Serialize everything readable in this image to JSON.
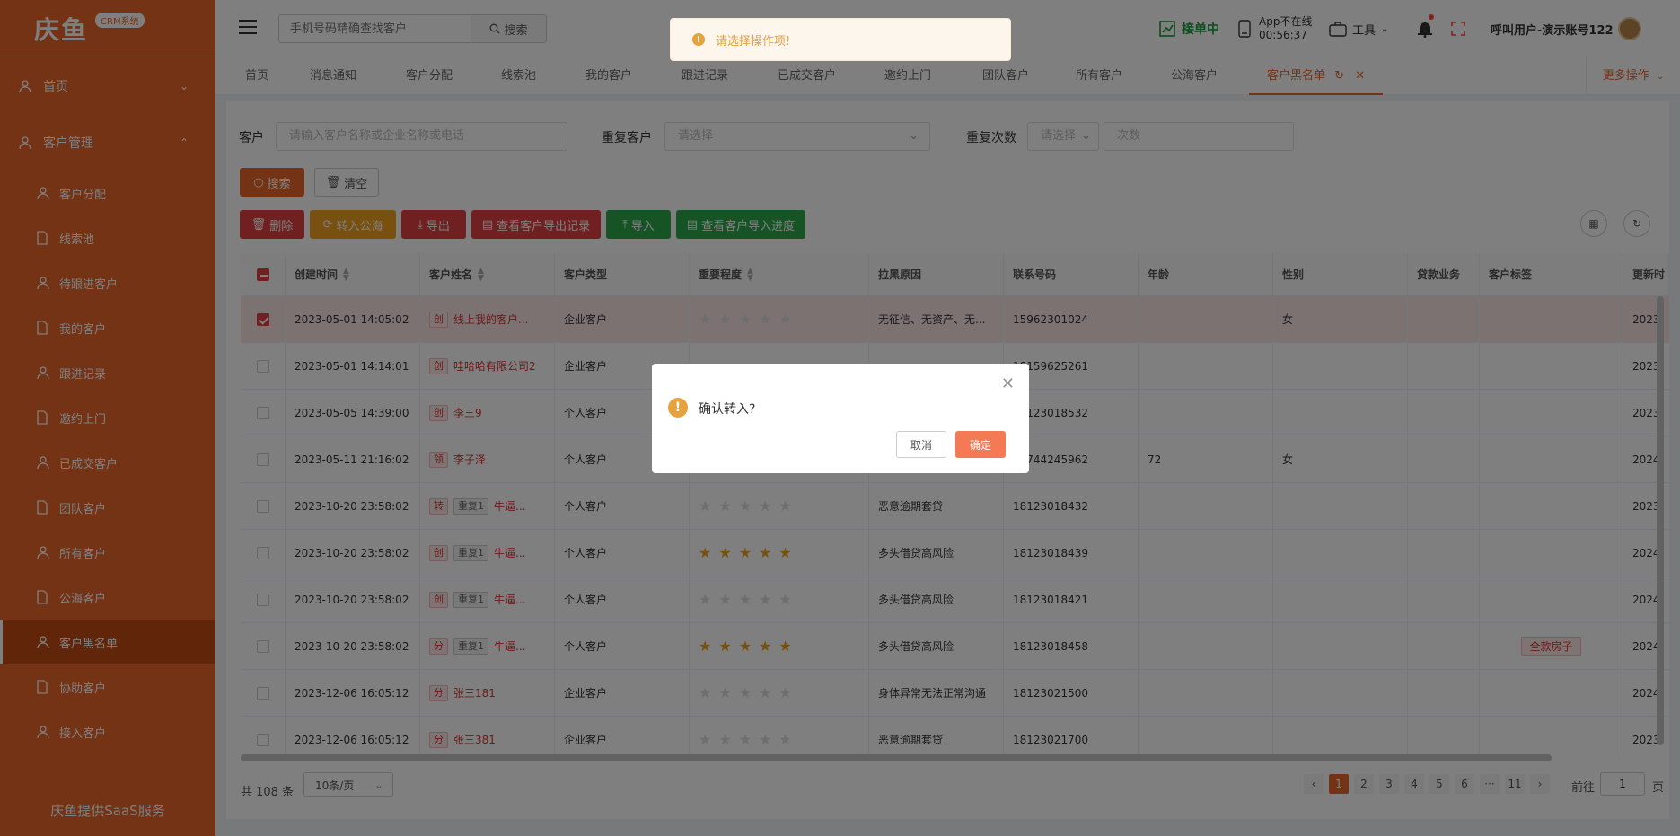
{
  "brand": {
    "logo_text": "庆鱼",
    "badge": "CRM系统",
    "footer": "庆鱼提供SaaS服务"
  },
  "sidebar": {
    "top_items": [
      {
        "label": "首页",
        "chevron": "⌄"
      },
      {
        "label": "客户管理",
        "chevron": "⌃"
      }
    ],
    "sub_items": [
      {
        "label": "客户分配"
      },
      {
        "label": "线索池"
      },
      {
        "label": "待跟进客户"
      },
      {
        "label": "我的客户"
      },
      {
        "label": "跟进记录"
      },
      {
        "label": "邀约上门"
      },
      {
        "label": "已成交客户"
      },
      {
        "label": "团队客户"
      },
      {
        "label": "所有客户"
      },
      {
        "label": "公海客户"
      },
      {
        "label": "客户黑名单"
      },
      {
        "label": "协助客户"
      },
      {
        "label": "接入客户"
      }
    ]
  },
  "header": {
    "search_placeholder": "手机号码精确查找客户",
    "search_label": "搜索",
    "jiedan": "接单中",
    "app_status": "App不在线",
    "app_time": "00:56:37",
    "tools": "工具",
    "user": "呼叫用户-演示账号122"
  },
  "tabs": {
    "items": [
      "首页",
      "消息通知",
      "客户分配",
      "线索池",
      "我的客户",
      "跟进记录",
      "已成交客户",
      "邀约上门",
      "团队客户",
      "所有客户",
      "公海客户"
    ],
    "active": "客户黑名单",
    "more": "更多操作"
  },
  "filters": {
    "customer_label": "客户",
    "customer_placeholder": "请输入客户名称或企业名称或电话",
    "repeat_label": "重复客户",
    "repeat_placeholder": "请选择",
    "count_label": "重复次数",
    "count_placeholder": "请选择",
    "count_input_placeholder": "次数"
  },
  "actions": {
    "search": "搜索",
    "clear": "清空",
    "delete": "删除",
    "to_public": "转入公海",
    "export": "导出",
    "export_log": "查看客户导出记录",
    "import": "导入",
    "import_progress": "查看客户导入进度"
  },
  "table": {
    "headers": [
      "创建时间",
      "客户姓名",
      "客户类型",
      "重要程度",
      "拉黑原因",
      "联系号码",
      "年龄",
      "性别",
      "贷款业务",
      "客户标签",
      "更新时"
    ],
    "rows": [
      {
        "time": "2023-05-01 14:05:02",
        "tag": "创",
        "repeat": "",
        "name": "线上我的客户...",
        "type": "企业客户",
        "stars": 0,
        "reason": "无征信、无资产、无...",
        "phone": "15962301024",
        "age": "",
        "gender": "女",
        "label": "",
        "update": "2023",
        "selected": true
      },
      {
        "time": "2023-05-01 14:14:01",
        "tag": "创",
        "repeat": "",
        "name": "哇哈哈有限公司2",
        "type": "企业客户",
        "stars": 0,
        "reason": "",
        "phone": "18159625261",
        "age": "",
        "gender": "",
        "label": "",
        "update": "2023",
        "selected": false
      },
      {
        "time": "2023-05-05 14:39:00",
        "tag": "创",
        "repeat": "",
        "name": "李三9",
        "type": "个人客户",
        "stars": 0,
        "reason": "",
        "phone": "18123018532",
        "age": "",
        "gender": "",
        "label": "",
        "update": "2023",
        "selected": false
      },
      {
        "time": "2023-05-11 21:16:02",
        "tag": "领",
        "repeat": "",
        "name": "李子泽",
        "type": "个人客户",
        "stars": 0,
        "reason": "",
        "phone": "18744245962",
        "age": "72",
        "gender": "女",
        "label": "",
        "update": "2024",
        "selected": false
      },
      {
        "time": "2023-10-20 23:58:02",
        "tag": "转",
        "repeat": "重复1",
        "name": "牛逼...",
        "type": "个人客户",
        "stars": 0,
        "reason": "恶意逾期套贷",
        "phone": "18123018432",
        "age": "",
        "gender": "",
        "label": "",
        "update": "2023",
        "selected": false
      },
      {
        "time": "2023-10-20 23:58:02",
        "tag": "创",
        "repeat": "重复1",
        "name": "牛逼...",
        "type": "个人客户",
        "stars": 5,
        "reason": "多头借贷高风险",
        "phone": "18123018439",
        "age": "",
        "gender": "",
        "label": "",
        "update": "2024",
        "selected": false
      },
      {
        "time": "2023-10-20 23:58:02",
        "tag": "创",
        "repeat": "重复1",
        "name": "牛逼...",
        "type": "个人客户",
        "stars": 0,
        "reason": "多头借贷高风险",
        "phone": "18123018421",
        "age": "",
        "gender": "",
        "label": "",
        "update": "2024",
        "selected": false
      },
      {
        "time": "2023-10-20 23:58:02",
        "tag": "分",
        "repeat": "重复1",
        "name": "牛逼...",
        "type": "个人客户",
        "stars": 5,
        "reason": "多头借贷高风险",
        "phone": "18123018458",
        "age": "",
        "gender": "",
        "label": "全款房子",
        "update": "2024",
        "selected": false
      },
      {
        "time": "2023-12-06 16:05:12",
        "tag": "分",
        "repeat": "",
        "name": "张三181",
        "type": "企业客户",
        "stars": 0,
        "reason": "身体异常无法正常沟通",
        "phone": "18123021500",
        "age": "",
        "gender": "",
        "label": "",
        "update": "2024",
        "selected": false
      },
      {
        "time": "2023-12-06 16:05:12",
        "tag": "分",
        "repeat": "",
        "name": "张三381",
        "type": "企业客户",
        "stars": 0,
        "reason": "恶意逾期套贷",
        "phone": "18123021700",
        "age": "",
        "gender": "",
        "label": "",
        "update": "2023",
        "selected": false
      }
    ]
  },
  "pagination": {
    "total": "共 108 条",
    "size": "10条/页",
    "pages": [
      "1",
      "2",
      "3",
      "4",
      "5",
      "6",
      "···",
      "11"
    ],
    "current": "1",
    "goto_label": "前往",
    "goto_value": "1",
    "goto_suffix": "页",
    "prev": "‹",
    "next": "›"
  },
  "toast": {
    "message": "请选择操作项!"
  },
  "dialog": {
    "message": "确认转入?",
    "cancel": "取消",
    "confirm": "确定"
  },
  "colors": {
    "brand": "#e8662a",
    "danger": "#e04040",
    "warning": "#e6a23c",
    "success": "#2fa84a"
  }
}
